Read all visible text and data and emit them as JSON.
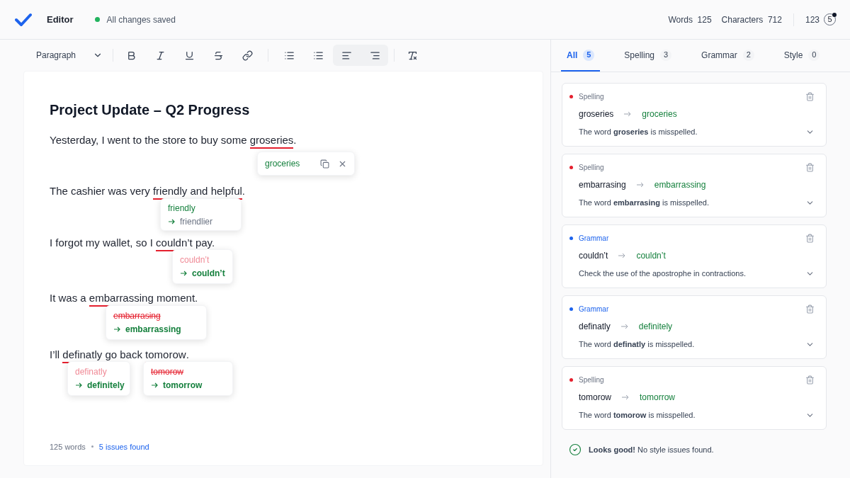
{
  "header": {
    "title": "Editor",
    "status": "All changes saved",
    "stats": [
      {
        "label": "Words",
        "value": "125"
      },
      {
        "label": "Characters",
        "value": "712"
      }
    ],
    "score": "123",
    "issues_badge": "5"
  },
  "toolbar": {
    "block_style": "Paragraph"
  },
  "document": {
    "title": "Project Update – Q2 Progress",
    "paragraphs": [
      {
        "segments": [
          {
            "text": "Yesterday, I went to the store to buy some ",
            "error": false
          },
          {
            "text": "groseries",
            "error": true
          },
          {
            "text": ".",
            "error": false
          }
        ]
      },
      {
        "segments": [
          {
            "text": "The cashier was very ",
            "error": false
          },
          {
            "text": "friendly",
            "error": true
          },
          {
            "text": " and ",
            "error": false
          },
          {
            "text": "helpful",
            "error": true
          },
          {
            "text": ".",
            "error": false
          }
        ]
      },
      {
        "segments": [
          {
            "text": "I forgot my wallet, so I ",
            "error": false
          },
          {
            "text": "couldn’t",
            "error": true
          },
          {
            "text": " pay.",
            "error": false
          }
        ]
      },
      {
        "segments": [
          {
            "text": "It was a ",
            "error": false
          },
          {
            "text": "embarrassing",
            "error": true
          },
          {
            "text": " moment.",
            "error": false
          }
        ]
      },
      {
        "segments": [
          {
            "text": "I’ll ",
            "error": false
          },
          {
            "text": "definatly",
            "error": true
          },
          {
            "text": " go back ",
            "error": false
          },
          {
            "text": "tomorow",
            "error": true
          },
          {
            "text": ".",
            "error": false
          }
        ]
      }
    ],
    "popups": [
      {
        "kind": "suggestion",
        "text": "groceries"
      },
      {
        "kind": "alternatives",
        "original": "friendly",
        "replacement": "friendlier"
      },
      {
        "kind": "correction",
        "original": "couldn’t",
        "struck": false,
        "replacement": "couldn’t"
      },
      {
        "kind": "correction",
        "original": "embarrasing",
        "struck": true,
        "replacement": "embarrassing"
      },
      {
        "kind": "correction",
        "original": "definatly",
        "struck": false,
        "replacement": "definitely"
      },
      {
        "kind": "correction",
        "original": "tomorow",
        "struck": true,
        "replacement": "tomorrow"
      }
    ],
    "footer": {
      "words": "125 words",
      "issues": "5 issues found"
    }
  },
  "panel": {
    "tabs": [
      {
        "label": "All",
        "count": "5",
        "selected": true
      },
      {
        "label": "Spelling",
        "count": "3",
        "selected": false
      },
      {
        "label": "Grammar",
        "count": "2",
        "selected": false
      },
      {
        "label": "Style",
        "count": "0",
        "selected": false
      }
    ],
    "issues": [
      {
        "kind": "spelling",
        "category": "Spelling",
        "color": "#e5202e",
        "original": "groseries",
        "replacement": "groceries",
        "message": "The word **groseries** is misspelled."
      },
      {
        "kind": "spelling",
        "category": "Spelling",
        "color": "#e5202e",
        "original": "embarrasing",
        "replacement": "embarrassing",
        "message": "The word **embarrasing** is misspelled."
      },
      {
        "kind": "grammar",
        "category": "Grammar",
        "color": "#1d63ed",
        "original": "couldn’t",
        "replacement": "couldn’t",
        "message": "Check the use of the apostrophe in contractions."
      },
      {
        "kind": "grammar",
        "category": "Grammar",
        "color": "#1d63ed",
        "original": "definatly",
        "replacement": "definitely",
        "message": "The word **definatly** is misspelled."
      },
      {
        "kind": "spelling",
        "category": "Spelling",
        "color": "#e5202e",
        "original": "tomorow",
        "replacement": "tomorrow",
        "message": "The word **tomorow** is misspelled."
      }
    ],
    "summary": "**Looks good!** No style issues found."
  }
}
